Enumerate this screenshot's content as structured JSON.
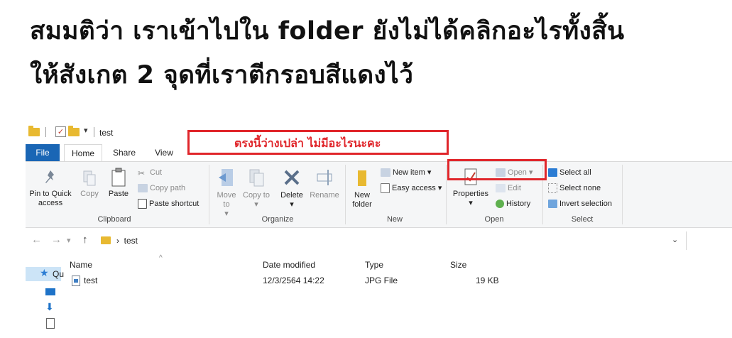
{
  "heading": {
    "line1": "สมมติว่า เราเข้าไปใน folder ยังไม่ได้คลิกอะไรทั้งสิ้น",
    "line2": "ให้สังเกต 2 จุดที่เราตีกรอบสีแดงไว้"
  },
  "titlebar": {
    "title": "test"
  },
  "annotation": {
    "text": "ตรงนี้ว่างเปล่า ไม่มีอะไรนะคะ"
  },
  "tabs": {
    "file": "File",
    "home": "Home",
    "share": "Share",
    "view": "View"
  },
  "ribbon": {
    "clipboard": {
      "label": "Clipboard",
      "pin": "Pin to Quick access",
      "copy": "Copy",
      "paste": "Paste",
      "cut": "Cut",
      "copy_path": "Copy path",
      "paste_shortcut": "Paste shortcut"
    },
    "organize": {
      "label": "Organize",
      "move_to": "Move to",
      "copy_to": "Copy to",
      "delete": "Delete",
      "rename": "Rename"
    },
    "new": {
      "label": "New",
      "new_folder": "New folder",
      "new_item": "New item",
      "easy_access": "Easy access"
    },
    "open": {
      "label": "Open",
      "properties": "Properties",
      "open": "Open",
      "edit": "Edit",
      "history": "History"
    },
    "select": {
      "label": "Select",
      "select_all": "Select all",
      "select_none": "Select none",
      "invert": "Invert selection"
    }
  },
  "addressbar": {
    "path": "test"
  },
  "filelist": {
    "columns": {
      "name": "Name",
      "date": "Date modified",
      "type": "Type",
      "size": "Size"
    },
    "rows": [
      {
        "name": "test",
        "date": "12/3/2564 14:22",
        "type": "JPG File",
        "size": "19 KB"
      }
    ]
  },
  "navpane": {
    "quick": "Qu"
  },
  "colors": {
    "accent": "#1a66b5",
    "annotation": "#e0262b",
    "folder": "#e8b931"
  }
}
